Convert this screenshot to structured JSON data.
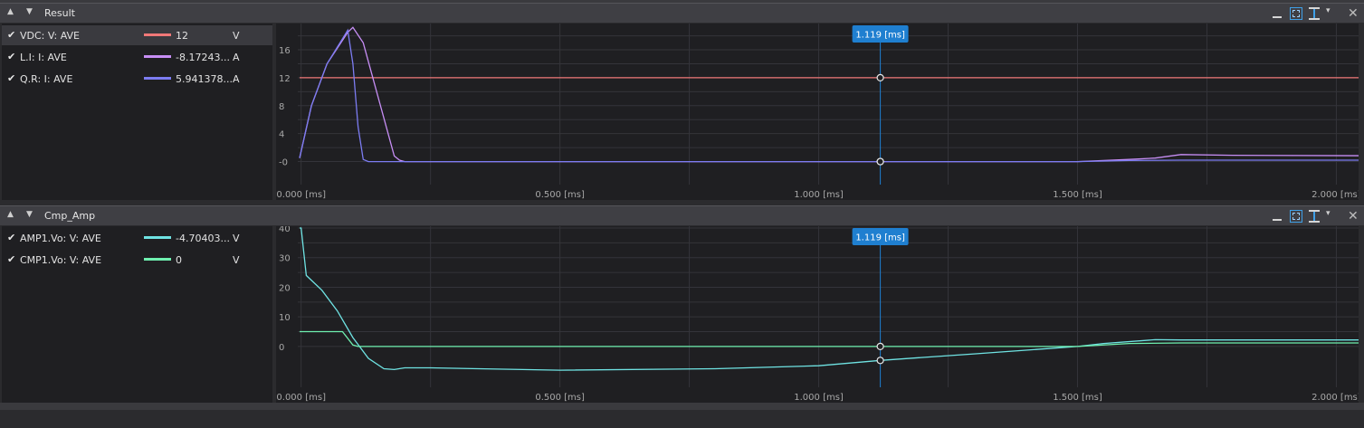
{
  "colors": {
    "vdc": "#f07878",
    "li": "#c78ef5",
    "qr": "#7c7cf2",
    "amp": "#6fe3e3",
    "cmp": "#6ff0b0",
    "cursor": "#1f7fd0",
    "grid": "#34343a"
  },
  "panels": [
    {
      "title": "Result",
      "legend": [
        {
          "name": "VDC: V: AVE",
          "value": "12",
          "unit": "V",
          "color": "#f07878",
          "selected": true
        },
        {
          "name": "L.I: I: AVE",
          "value": "-8.17243...",
          "unit": "A",
          "color": "#c78ef5",
          "selected": false
        },
        {
          "name": "Q.R: I: AVE",
          "value": "5.941378...",
          "unit": "A",
          "color": "#7c7cf2",
          "selected": false
        }
      ],
      "cursor_label": "1.119 [ms]",
      "icons": [
        "minimize-icon",
        "fit-all-icon",
        "fit-y-icon",
        "chevron-down-icon",
        "close-icon"
      ]
    },
    {
      "title": "Cmp_Amp",
      "legend": [
        {
          "name": "AMP1.Vo: V: AVE",
          "value": "-4.70403...",
          "unit": "V",
          "color": "#6fe3e3",
          "selected": false
        },
        {
          "name": "CMP1.Vo: V: AVE",
          "value": "0",
          "unit": "V",
          "color": "#6ff0b0",
          "selected": false
        }
      ],
      "cursor_label": "1.119 [ms]",
      "icons": [
        "minimize-icon",
        "fit-all-icon",
        "fit-y-icon",
        "chevron-down-icon",
        "close-icon"
      ]
    }
  ],
  "chart_data": [
    {
      "type": "line",
      "x_unit": "ms",
      "xlim": [
        -0.003,
        2.2
      ],
      "ylim": [
        -2,
        19.5
      ],
      "x_ticks": [
        0.0,
        0.5,
        1.0,
        1.5,
        2.0
      ],
      "x_tick_labels": [
        "0.000 [ms]",
        "0.500 [ms]",
        "1.000 [ms]",
        "1.500 [ms]",
        "2.000 [ms]"
      ],
      "y_ticks": [
        0,
        4,
        8,
        12,
        16
      ],
      "y_tick_labels": [
        "-0",
        "4",
        "8",
        "12",
        "16"
      ],
      "cursor_x": 1.119,
      "grid": true,
      "series": [
        {
          "name": "VDC: V: AVE",
          "color": "#f07878",
          "x": [
            -0.003,
            2.2
          ],
          "y": [
            12,
            12
          ]
        },
        {
          "name": "L.I: I: AVE",
          "color": "#c78ef5",
          "x": [
            -0.003,
            0.02,
            0.05,
            0.09,
            0.1,
            0.12,
            0.18,
            0.19,
            0.2,
            1.5,
            1.6,
            1.65,
            1.7,
            1.8,
            2.2
          ],
          "y": [
            0.5,
            8,
            14,
            18.5,
            19.2,
            17,
            0.8,
            0.2,
            0,
            0,
            0.3,
            0.5,
            1,
            0.9,
            0.8
          ]
        },
        {
          "name": "Q.R: I: AVE",
          "color": "#7c7cf2",
          "x": [
            -0.003,
            0.02,
            0.05,
            0.09,
            0.1,
            0.11,
            0.12,
            0.13,
            1.5,
            1.6,
            1.7,
            2.2
          ],
          "y": [
            0.5,
            8,
            14,
            18.8,
            14,
            5,
            0.3,
            0,
            0,
            0.15,
            0.2,
            0.2
          ]
        }
      ]
    },
    {
      "type": "line",
      "x_unit": "ms",
      "xlim": [
        -0.003,
        2.2
      ],
      "ylim": [
        -15,
        40
      ],
      "x_ticks": [
        0.0,
        0.5,
        1.0,
        1.5,
        2.0
      ],
      "x_tick_labels": [
        "0.000 [ms]",
        "0.500 [ms]",
        "1.000 [ms]",
        "1.500 [ms]",
        "2.000 [ms]"
      ],
      "y_ticks": [
        0,
        10,
        20,
        30,
        40
      ],
      "y_tick_labels": [
        "0",
        "10",
        "20",
        "30",
        "40"
      ],
      "cursor_x": 1.119,
      "grid": true,
      "series": [
        {
          "name": "AMP1.Vo: V: AVE",
          "color": "#6fe3e3",
          "x": [
            -0.003,
            0.0,
            0.01,
            0.04,
            0.07,
            0.1,
            0.13,
            0.16,
            0.18,
            0.2,
            0.25,
            0.5,
            0.8,
            1.0,
            1.119,
            1.3,
            1.5,
            1.55,
            1.65,
            1.7,
            1.9,
            2.2
          ],
          "y": [
            40,
            40,
            24,
            19,
            12,
            3,
            -4,
            -7.5,
            -7.8,
            -7.2,
            -7.2,
            -8.0,
            -7.5,
            -6.5,
            -4.7,
            -2.5,
            0,
            1,
            2.3,
            2.2,
            2.2,
            2.2
          ]
        },
        {
          "name": "CMP1.Vo: V: AVE",
          "color": "#6ff0b0",
          "x": [
            -0.003,
            0.08,
            0.1,
            0.11,
            1.5,
            1.6,
            1.7,
            2.2
          ],
          "y": [
            5,
            5,
            0.5,
            0,
            0,
            1,
            1.2,
            1.2
          ]
        }
      ]
    }
  ]
}
